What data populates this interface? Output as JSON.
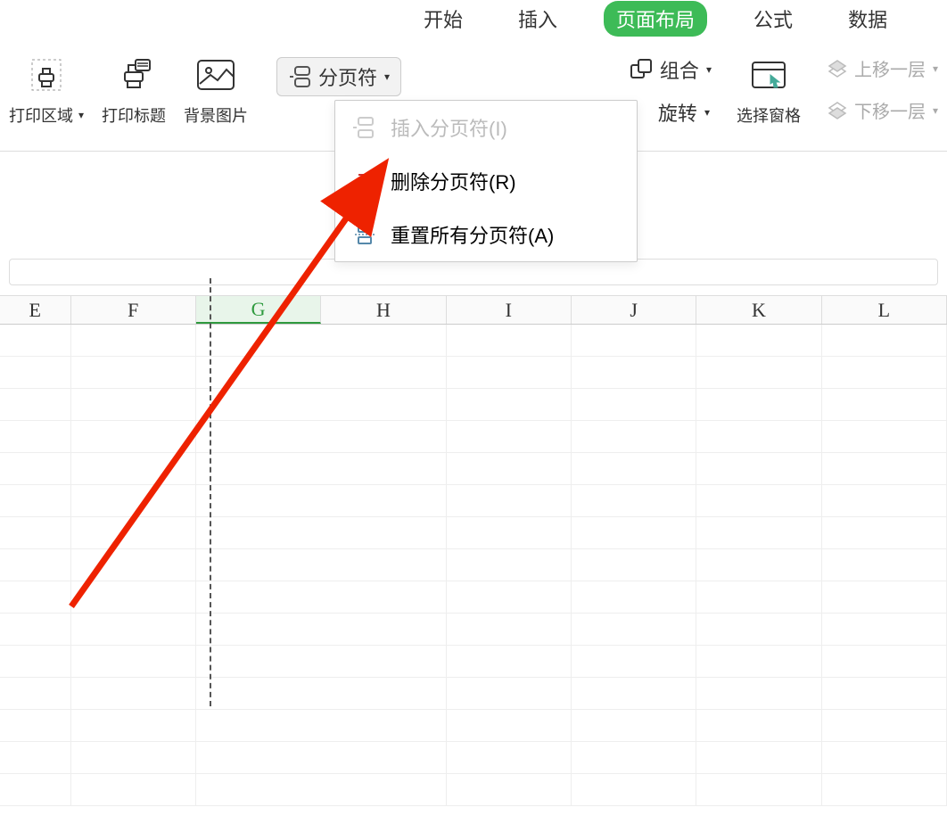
{
  "menu": {
    "tabs": [
      "开始",
      "插入",
      "页面布局",
      "公式",
      "数据"
    ],
    "active_index": 2
  },
  "ribbon": {
    "print_area": "打印区域",
    "print_titles": "打印标题",
    "background": "背景图片",
    "page_break": "分页符",
    "rotate": "旋转",
    "group": "组合",
    "selection_pane": "选择窗格",
    "bring_forward": "上移一层",
    "send_backward": "下移一层"
  },
  "dropdown": {
    "insert": "插入分页符(I)",
    "remove": "删除分页符(R)",
    "reset": "重置所有分页符(A)"
  },
  "columns": [
    "E",
    "F",
    "G",
    "H",
    "I",
    "J",
    "K",
    "L"
  ],
  "selected_column": "G"
}
